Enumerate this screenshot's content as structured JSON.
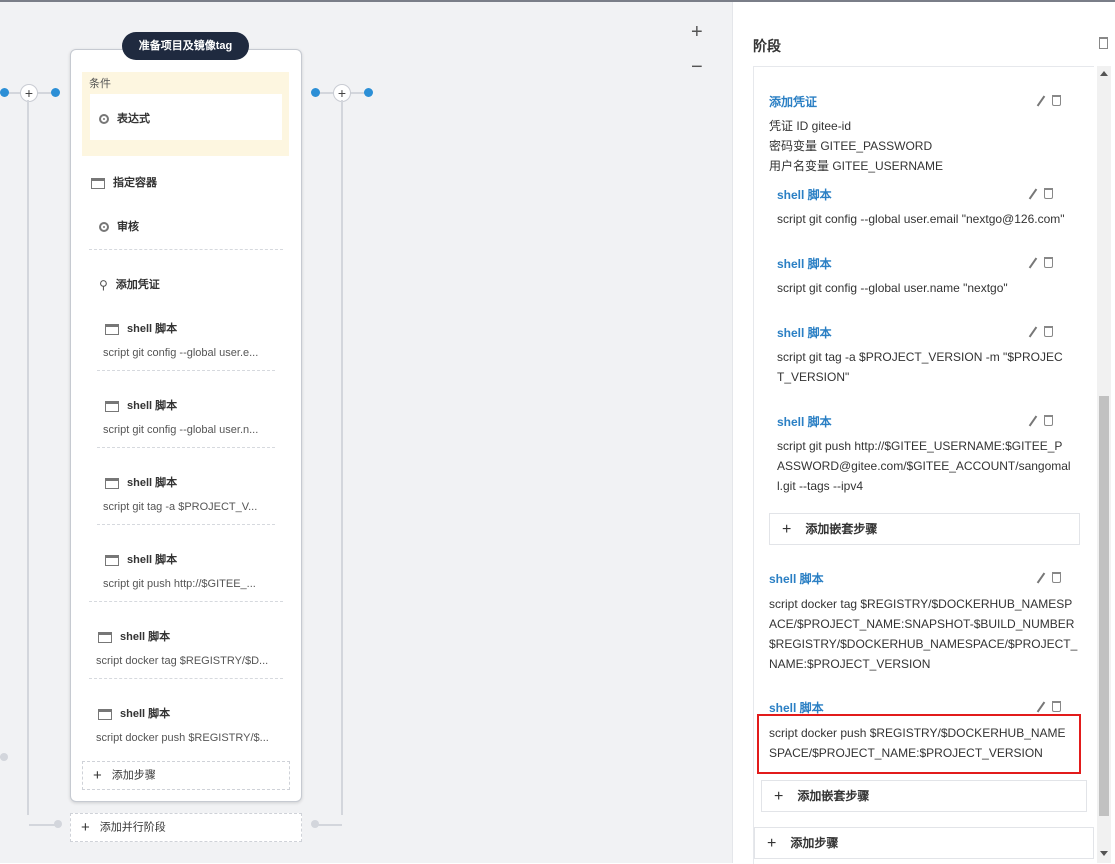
{
  "canvas": {
    "zoom_in": "+",
    "zoom_out": "−",
    "stage": {
      "title": "准备项目及镜像tag",
      "condition_label": "条件",
      "condition_item": "表达式",
      "container": "指定容器",
      "review": "审核",
      "credential": "添加凭证",
      "shell_steps": [
        {
          "title": "shell 脚本",
          "script": "script   git config --global user.e..."
        },
        {
          "title": "shell 脚本",
          "script": "script   git config --global user.n..."
        },
        {
          "title": "shell 脚本",
          "script": "script   git tag -a $PROJECT_V..."
        },
        {
          "title": "shell 脚本",
          "script": "script   git push http://$GITEE_..."
        }
      ],
      "outer_steps": [
        {
          "title": "shell 脚本",
          "script": "script   docker tag $REGISTRY/$D..."
        },
        {
          "title": "shell 脚本",
          "script": "script   docker push $REGISTRY/$..."
        }
      ],
      "add_step": "添加步骤"
    },
    "add_parallel": "添加并行阶段"
  },
  "panel": {
    "title": "阶段",
    "credential": {
      "title": "添加凭证",
      "lines": [
        "凭证 ID   gitee-id",
        "密码变量   GITEE_PASSWORD",
        "用户名变量   GITEE_USERNAME"
      ]
    },
    "nested_steps": [
      {
        "title": "shell 脚本",
        "lines": [
          "script   git config --global user.email \"nextgo@126.com\""
        ]
      },
      {
        "title": "shell 脚本",
        "lines": [
          "script   git config --global user.name \"nextgo\""
        ]
      },
      {
        "title": "shell 脚本",
        "lines": [
          "script   git tag -a $PROJECT_VERSION -m \"$PROJEC",
          "T_VERSION\""
        ]
      },
      {
        "title": "shell 脚本",
        "lines": [
          "script   git push http://$GITEE_USERNAME:$GITEE_P",
          "ASSWORD@gitee.com/$GITEE_ACCOUNT/sangomal",
          "l.git --tags --ipv4"
        ]
      }
    ],
    "add_nested": "添加嵌套步骤",
    "step_docker_tag": {
      "title": "shell 脚本",
      "lines": [
        "script   docker tag $REGISTRY/$DOCKERHUB_NAMESP",
        "ACE/$PROJECT_NAME:SNAPSHOT-$BUILD_NUMBER",
        "$REGISTRY/$DOCKERHUB_NAMESPACE/$PROJECT_",
        "NAME:$PROJECT_VERSION"
      ]
    },
    "step_docker_push": {
      "title": "shell 脚本",
      "lines": [
        "script   docker push $REGISTRY/$DOCKERHUB_NAME",
        "SPACE/$PROJECT_NAME:$PROJECT_VERSION"
      ]
    },
    "add_nested_2": "添加嵌套步骤",
    "add_step": "添加步骤"
  }
}
